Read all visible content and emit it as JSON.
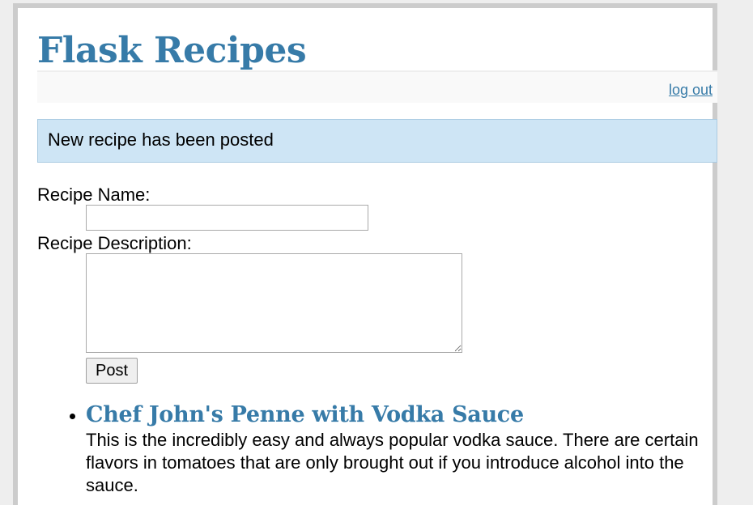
{
  "header": {
    "title": "Flask Recipes",
    "logout_label": "log out"
  },
  "flash": {
    "message": "New recipe has been posted"
  },
  "form": {
    "name_label": "Recipe Name:",
    "name_value": "",
    "description_label": "Recipe Description:",
    "description_value": "",
    "submit_label": "Post"
  },
  "entries": [
    {
      "title": "Chef John's Penne with Vodka Sauce",
      "description": "This is the incredibly easy and always popular vodka sauce. There are certain flavors in tomatoes that are only brought out if you introduce alcohol into the sauce."
    }
  ],
  "colors": {
    "accent": "#377ba8",
    "flash_background": "#cee5f5",
    "page_border": "#cccccc"
  }
}
